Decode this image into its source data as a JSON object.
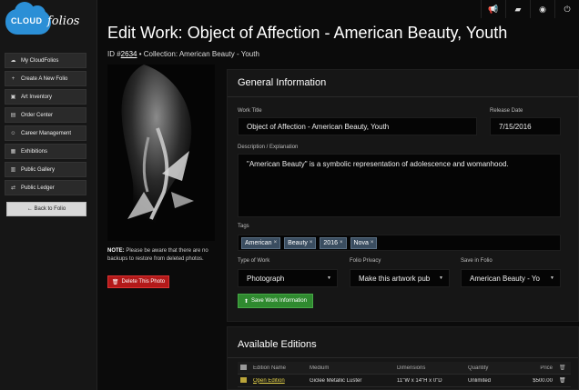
{
  "brand": {
    "part1": "CLOUD",
    "part2": "folios"
  },
  "sidebar": {
    "items": [
      {
        "icon": "cloud-icon",
        "glyph": "☁",
        "label": "My CloudFolios"
      },
      {
        "icon": "plus-icon",
        "glyph": "+",
        "label": "Create A New Folio"
      },
      {
        "icon": "image-icon",
        "glyph": "▣",
        "label": "Art Inventory"
      },
      {
        "icon": "calendar-icon",
        "glyph": "▤",
        "label": "Order Center"
      },
      {
        "icon": "user-icon",
        "glyph": "☺",
        "label": "Career Management"
      },
      {
        "icon": "gallery-icon",
        "glyph": "▦",
        "label": "Exhibitions"
      },
      {
        "icon": "grid-icon",
        "glyph": "▥",
        "label": "Public Gallery"
      },
      {
        "icon": "transfer-icon",
        "glyph": "⇄",
        "label": "Public Ledger"
      }
    ],
    "back_label": "← Back to Folio"
  },
  "topbar": {
    "icons": [
      {
        "name": "megaphone-icon",
        "glyph": "📢"
      },
      {
        "name": "briefcase-icon",
        "glyph": "▰"
      },
      {
        "name": "account-icon",
        "glyph": "◉"
      },
      {
        "name": "power-icon",
        "glyph": "⏻"
      }
    ]
  },
  "header": {
    "title": "Edit Work: Object of Affection - American Beauty, Youth",
    "id_prefix": "ID #",
    "id_value": "2634",
    "collection": " • Collection: American Beauty - Youth"
  },
  "photo_note": {
    "bold": "NOTE:",
    "text": " Please be aware that there are no backups to restore from deleted photos."
  },
  "delete_label": "Delete This Photo",
  "general": {
    "title": "General Information",
    "work_title_label": "Work Title",
    "work_title_value": "Object of Affection - American Beauty, Youth",
    "release_label": "Release Date",
    "release_value": "7/15/2016",
    "desc_label": "Description / Explanation",
    "desc_value": "\"American Beauty\" is a symbolic representation of adolescence and womanhood.",
    "tags_label": "Tags",
    "tags": [
      "American",
      "Beauty",
      "2016",
      "Nova"
    ],
    "type_label": "Type of Work",
    "type_value": "Photograph",
    "privacy_label": "Folio Privacy",
    "privacy_value": "Make this artwork pub",
    "save_in_label": "Save in Folio",
    "save_in_value": "American Beauty - Yo",
    "save_label": "Save Work Information"
  },
  "editions": {
    "title": "Available Editions",
    "headers": [
      "",
      "Edition Name",
      "Medium",
      "Dimensions",
      "Quantity",
      "Price",
      ""
    ],
    "rows": [
      {
        "name": "Open Edition",
        "medium": "Giclee Metallic Luster",
        "dimensions": "11\"W x 14\"H x 0\"D",
        "quantity": "Unlimited",
        "price": "$500.00"
      }
    ]
  }
}
